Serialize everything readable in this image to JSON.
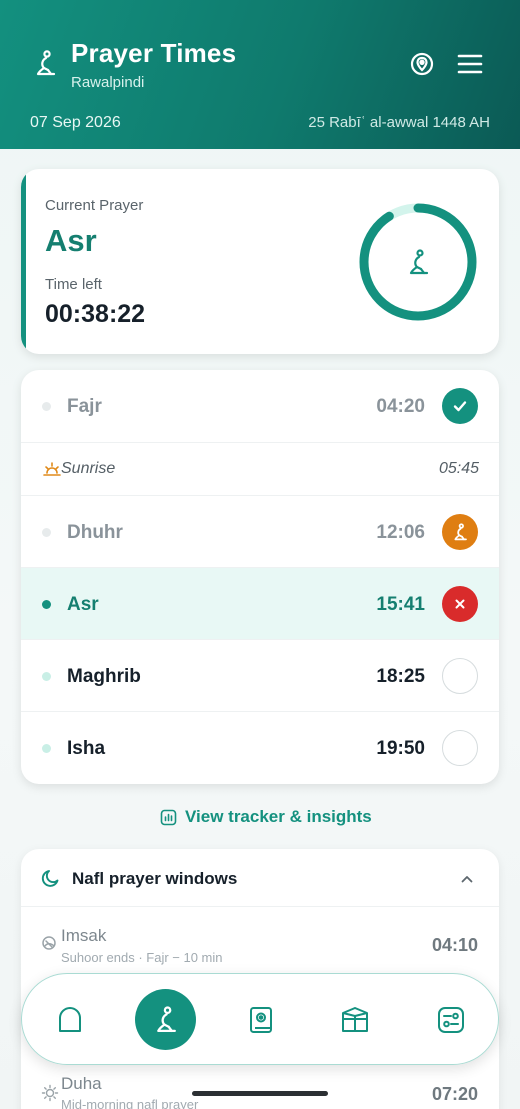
{
  "header": {
    "title": "Prayer Times",
    "city": "Rawalpindi",
    "date_gregorian": "07 Sep 2026",
    "date_hijri": "25 Rabīʿ al-awwal 1448 AH",
    "logo_icon": "prayer-person-icon",
    "locate_icon": "location-target-icon",
    "menu_icon": "hamburger-menu-icon"
  },
  "current": {
    "label": "Current Prayer",
    "prayer": "Asr",
    "time_left_label": "Time left",
    "time_left": "00:38:22",
    "progress_fraction": 0.91,
    "icon": "prayer-person-icon"
  },
  "prayers": [
    {
      "name": "Fajr",
      "time": "04:20",
      "status": "prayed",
      "status_icon": "check-icon"
    },
    {
      "name": "Sunrise",
      "time": "05:45",
      "status": "info",
      "status_icon": "sunrise-icon"
    },
    {
      "name": "Dhuhr",
      "time": "12:06",
      "status": "late",
      "status_icon": "prayer-person-icon"
    },
    {
      "name": "Asr",
      "time": "15:41",
      "status": "missed",
      "status_icon": "close-icon"
    },
    {
      "name": "Maghrib",
      "time": "18:25",
      "status": "upcoming",
      "status_icon": "empty-circle"
    },
    {
      "name": "Isha",
      "time": "19:50",
      "status": "upcoming",
      "status_icon": "empty-circle"
    }
  ],
  "tracker": {
    "label": "View tracker & insights",
    "icon": "bar-chart-icon"
  },
  "nafl": {
    "title": "Nafl prayer windows",
    "icon": "moon-icon",
    "items": [
      {
        "name": "Imsak",
        "subtitle": "Suhoor ends · Fajr − 10 min",
        "time": "04:10",
        "icon": "imsak-icon"
      },
      {
        "name": "Duha",
        "subtitle": "Mid-morning nafl prayer",
        "time": "07:20",
        "icon": "sun-icon"
      }
    ]
  },
  "nav": {
    "items": [
      "home-icon",
      "prayer-person-icon",
      "quran-book-icon",
      "kaaba-icon",
      "settings-icon"
    ],
    "active": "prayer-person-icon"
  },
  "colors": {
    "primary": "#14917f",
    "late": "#df7e12",
    "missed": "#d92b2b",
    "header_dark": "#0b5a55"
  }
}
